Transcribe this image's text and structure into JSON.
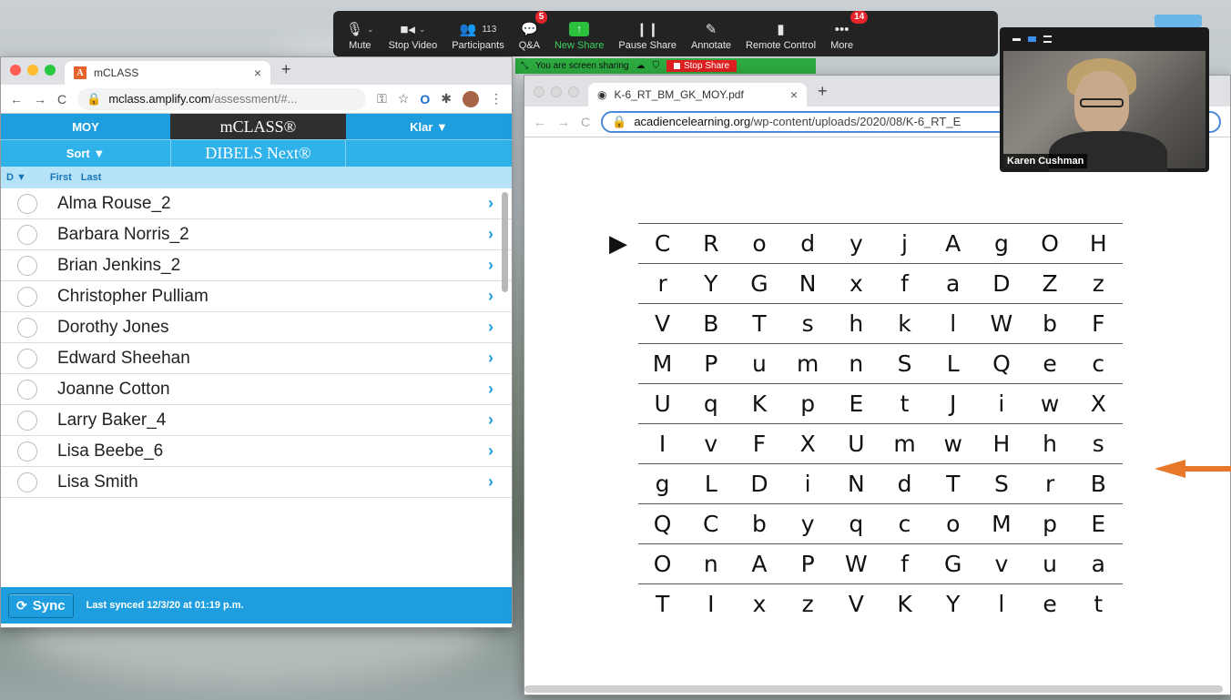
{
  "zoom_toolbar": {
    "items": [
      {
        "label": "Mute",
        "icon": "microphone-icon"
      },
      {
        "label": "Stop Video",
        "icon": "video-camera-icon"
      },
      {
        "label": "Participants",
        "icon": "participants-icon",
        "count": "113"
      },
      {
        "label": "Q&A",
        "icon": "qa-icon",
        "badge": "5"
      },
      {
        "label": "New Share",
        "icon": "share-screen-icon"
      },
      {
        "label": "Pause Share",
        "icon": "pause-icon"
      },
      {
        "label": "Annotate",
        "icon": "pencil-icon"
      },
      {
        "label": "Remote Control",
        "icon": "mouse-icon"
      },
      {
        "label": "More",
        "icon": "more-icon",
        "badge": "14"
      }
    ]
  },
  "share_banner": {
    "text": "You are screen sharing",
    "stop_label": "Stop Share"
  },
  "left_browser": {
    "tab_title": "mCLASS",
    "favicon_letter": "A",
    "url_host": "mclass.amplify.com",
    "url_path": "/assessment/#...",
    "header": {
      "period": "MOY",
      "brand": "mCLASS®",
      "user": "Klar ▼"
    },
    "subheader": {
      "sort": "Sort ▼",
      "program": "DIBELS Next®"
    },
    "columns": {
      "d": "D ▼",
      "first": "First",
      "last": "Last"
    },
    "students": [
      "Alma Rouse_2",
      "Barbara Norris_2",
      "Brian Jenkins_2",
      "Christopher Pulliam",
      "Dorothy Jones",
      "Edward Sheehan",
      "Joanne Cotton",
      "Larry Baker_4",
      "Lisa Beebe_6",
      "Lisa Smith"
    ],
    "footer": {
      "sync_label": "Sync",
      "last_synced": "Last synced 12/3/20 at 01:19 p.m."
    }
  },
  "right_browser": {
    "tab_title": "K-6_RT_BM_GK_MOY.pdf",
    "url_host": "acadiencelearning.org",
    "url_path": "/wp-content/uploads/2020/08/K-6_RT_E",
    "letter_rows": [
      [
        "C",
        "R",
        "o",
        "d",
        "y",
        "j",
        "A",
        "g",
        "O",
        "H"
      ],
      [
        "r",
        "Y",
        "G",
        "N",
        "x",
        "f",
        "a",
        "D",
        "Z",
        "z"
      ],
      [
        "V",
        "B",
        "T",
        "s",
        "h",
        "k",
        "l",
        "W",
        "b",
        "F"
      ],
      [
        "M",
        "P",
        "u",
        "m",
        "n",
        "S",
        "L",
        "Q",
        "e",
        "c"
      ],
      [
        "U",
        "q",
        "K",
        "p",
        "E",
        "t",
        "J",
        "i",
        "w",
        "X"
      ],
      [
        "I",
        "v",
        "F",
        "X",
        "U",
        "m",
        "w",
        "H",
        "h",
        "s"
      ],
      [
        "g",
        "L",
        "D",
        "i",
        "N",
        "d",
        "T",
        "S",
        "r",
        "B"
      ],
      [
        "Q",
        "C",
        "b",
        "y",
        "q",
        "c",
        "o",
        "M",
        "p",
        "E"
      ],
      [
        "O",
        "n",
        "A",
        "P",
        "W",
        "f",
        "G",
        "v",
        "u",
        "a"
      ],
      [
        "T",
        "I",
        "x",
        "z",
        "V",
        "K",
        "Y",
        "l",
        "e",
        "t"
      ]
    ]
  },
  "video_panel": {
    "participant_name": "Karen Cushman"
  },
  "colors": {
    "mclass_blue": "#1e9ede",
    "zoom_green": "#2ca93f",
    "stop_red": "#e02020",
    "arrow_orange": "#e8782a"
  }
}
